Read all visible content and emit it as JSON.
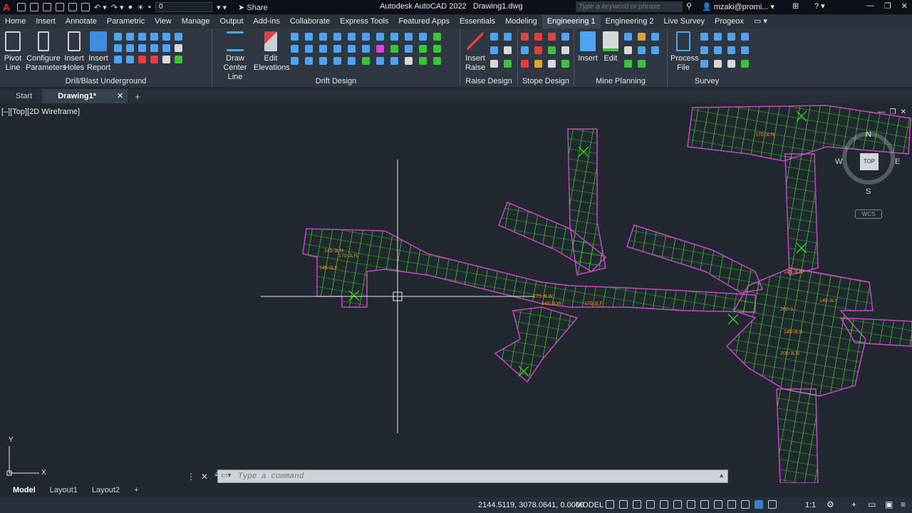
{
  "app": {
    "title": "Autodesk AutoCAD 2022",
    "file": "Drawing1.dwg",
    "logo_letter": "A",
    "layer_value": "0",
    "share_label": "Share",
    "search_placeholder": "Type a keyword or phrase",
    "user": "mzaki@promi..."
  },
  "tabs": [
    {
      "label": "Home"
    },
    {
      "label": "Insert"
    },
    {
      "label": "Annotate"
    },
    {
      "label": "Parametric"
    },
    {
      "label": "View"
    },
    {
      "label": "Manage"
    },
    {
      "label": "Output"
    },
    {
      "label": "Add-ins"
    },
    {
      "label": "Collaborate"
    },
    {
      "label": "Express Tools"
    },
    {
      "label": "Featured Apps"
    },
    {
      "label": "Essentials"
    },
    {
      "label": "Modeling"
    },
    {
      "label": "Engineering 1"
    },
    {
      "label": "Engineering 2"
    },
    {
      "label": "Live Survey"
    },
    {
      "label": "Progeox"
    }
  ],
  "ribbon": {
    "drill": {
      "title": "Drill/Blast Underground",
      "btn1_l1": "Pivot",
      "btn1_l2": "Line",
      "btn2_l1": "Configure",
      "btn2_l2": "Parameters",
      "btn3_l1": "Insert",
      "btn3_l2": "Holes",
      "btn4_l1": "Insert",
      "btn4_l2": "Report"
    },
    "drift": {
      "title": "Drift Design",
      "btn1_l1": "Draw",
      "btn1_l2": "Center Line",
      "btn2_l1": "Edit",
      "btn2_l2": "Elevations"
    },
    "raise": {
      "title": "Raise Design",
      "btn1_l1": "Insert",
      "btn1_l2": "Raise"
    },
    "stope": {
      "title": "Stope Design"
    },
    "mine": {
      "title": "Mine Planning",
      "btn1": "Insert",
      "btn2": "Edit"
    },
    "survey": {
      "title": "Survey",
      "btn1_l1": "Process",
      "btn1_l2": "File"
    }
  },
  "doc_tabs": {
    "start": "Start",
    "active": "Drawing1*",
    "close": "✕",
    "add": "+"
  },
  "viewport": {
    "label": "[–][Top][2D Wireframe]"
  },
  "viewcube": {
    "top": "TOP",
    "n": "N",
    "s": "S",
    "e": "E",
    "w": "W",
    "wcs": "WCS"
  },
  "ucs": {
    "y": "Y",
    "x": "X"
  },
  "command": {
    "placeholder": "Type a command"
  },
  "layout_tabs": [
    {
      "label": "Model"
    },
    {
      "label": "Layout1"
    },
    {
      "label": "Layout2"
    }
  ],
  "status": {
    "coords": "2144.5119, 3078.0641, 0.0000",
    "model": "MODEL",
    "scale": "1:1"
  },
  "annotations": [
    "145-3LN",
    "170-2LN",
    "145-3LF",
    "170-3LW",
    "145-3LW",
    "170-3LF",
    "145-3LS",
    "200-3",
    "145-3LY",
    "170-3LN",
    "145-3LN",
    "200-3LN"
  ],
  "colors": {
    "accent": "#3d7fd1",
    "drift_green": "#39ff14",
    "drift_magenta": "#d040d0",
    "label_orange": "#ff8a1e"
  }
}
